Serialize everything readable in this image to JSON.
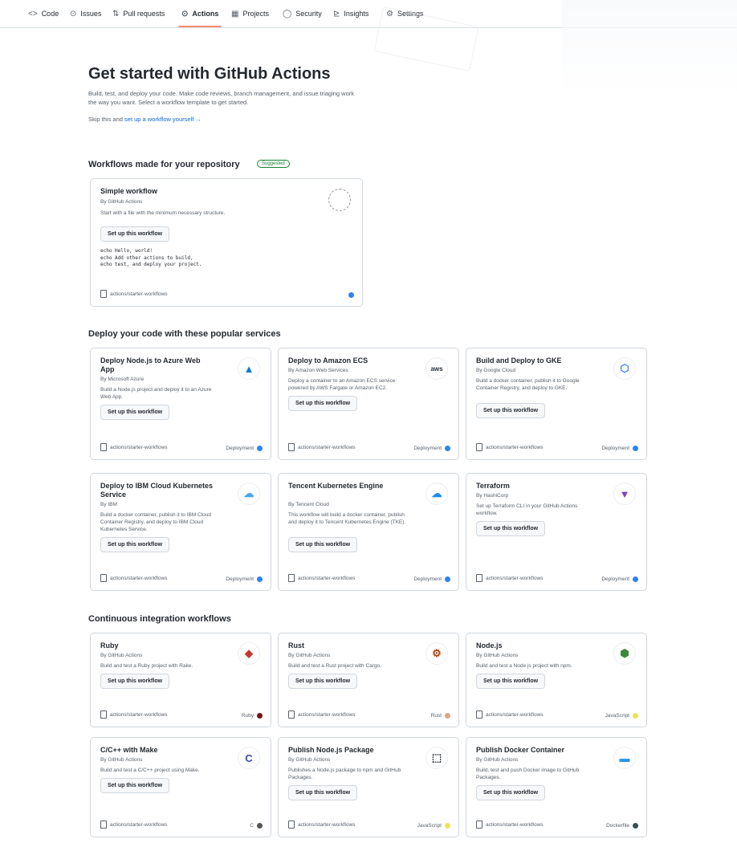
{
  "nav": {
    "tabs": [
      {
        "label": "Code",
        "icon": "code-icon"
      },
      {
        "label": "Issues",
        "icon": "issue-icon"
      },
      {
        "label": "Pull requests",
        "icon": "pull-request-icon"
      },
      {
        "label": "Actions",
        "icon": "play-icon",
        "active": true
      },
      {
        "label": "Projects",
        "icon": "project-icon"
      },
      {
        "label": "Security",
        "icon": "shield-icon"
      },
      {
        "label": "Insights",
        "icon": "graph-icon"
      },
      {
        "label": "Settings",
        "icon": "gear-icon"
      }
    ]
  },
  "header": {
    "title": "Get started with GitHub Actions",
    "intro": "Build, test, and deploy your code. Make code reviews, branch management, and issue triaging work the way you want. Select a workflow template to get started.",
    "skip_prefix": "Skip this and ",
    "skip_link": "set up a workflow yourself",
    "skip_arrow": "→"
  },
  "sections": {
    "suggested": {
      "title": "Workflows made for your repository",
      "badge": "Suggested"
    },
    "deploy": {
      "title": "Deploy your code with these popular services"
    },
    "ci": {
      "title": "Continuous integration workflows"
    }
  },
  "button_label": "Set up this workflow",
  "repo_label": "actions/starter-workflows",
  "simple": {
    "title": "Simple workflow",
    "by": "By GitHub Actions",
    "desc": "Start with a file with the minimum necessary structure.",
    "code": "echo Hello, world!\necho Add other actions to build,\necho test, and deploy your project."
  },
  "deploy_cards": [
    {
      "title": "Deploy Node.js to Azure Web App",
      "by": "By Microsoft Azure",
      "desc": "Build a Node.js project and deploy it to an Azure Web App.",
      "category": "Deployment",
      "dot_color": "#2f81f7",
      "logo": "azure-logo-icon",
      "glyph": "▲",
      "glyph_color": "#0078d4"
    },
    {
      "title": "Deploy to Amazon ECS",
      "by": "By Amazon Web Services",
      "desc": "Deploy a container to an Amazon ECS service powered by AWS Fargate or Amazon EC2.",
      "category": "Deployment",
      "dot_color": "#2f81f7",
      "logo": "aws-logo-icon",
      "glyph": "aws",
      "glyph_color": "#232f3e"
    },
    {
      "title": "Build and Deploy to GKE",
      "by": "By Google Cloud",
      "desc": "Build a docker container, publish it to Google Container Registry, and deploy to GKE.",
      "category": "Deployment",
      "dot_color": "#2f81f7",
      "logo": "gke-logo-icon",
      "glyph": "⬡",
      "glyph_color": "#4285f4"
    },
    {
      "title": "Deploy to IBM Cloud Kubernetes Service",
      "by": "By IBM",
      "desc": "Build a docker container, publish it to IBM Cloud Container Registry, and deploy to IBM Cloud Kubernetes Service.",
      "category": "Deployment",
      "dot_color": "#2f81f7",
      "logo": "ibm-cloud-logo-icon",
      "glyph": "☁",
      "glyph_color": "#4aa5f0"
    },
    {
      "title": "Tencent Kubernetes Engine",
      "by": "By Tencent Cloud",
      "desc": "This workflow will build a docker container, publish and deploy it to Tencent Kubernetes Engine (TKE).",
      "category": "Deployment",
      "dot_color": "#2f81f7",
      "logo": "tencent-logo-icon",
      "glyph": "☁",
      "glyph_color": "#1f8ceb"
    },
    {
      "title": "Terraform",
      "by": "By HashiCorp",
      "desc": "Set up Terraform CLI in your GitHub Actions workflow.",
      "category": "Deployment",
      "dot_color": "#2f81f7",
      "logo": "terraform-logo-icon",
      "glyph": "▼",
      "glyph_color": "#7b42bc"
    }
  ],
  "ci_cards": [
    {
      "title": "Ruby",
      "by": "By GitHub Actions",
      "desc": "Build and test a Ruby project with Rake.",
      "category": "Ruby",
      "dot_color": "#701516",
      "logo": "ruby-logo-icon",
      "glyph": "◆",
      "glyph_color": "#cc342d"
    },
    {
      "title": "Rust",
      "by": "By GitHub Actions",
      "desc": "Build and test a Rust project with Cargo.",
      "category": "Rust",
      "dot_color": "#dea584",
      "logo": "rust-logo-icon",
      "glyph": "⚙",
      "glyph_color": "#b7410e"
    },
    {
      "title": "Node.js",
      "by": "By GitHub Actions",
      "desc": "Build and test a Node.js project with npm.",
      "category": "JavaScript",
      "dot_color": "#f1e05a",
      "logo": "nodejs-logo-icon",
      "glyph": "⬢",
      "glyph_color": "#3c873a"
    },
    {
      "title": "C/C++ with Make",
      "by": "By GitHub Actions",
      "desc": "Build and test a C/C++ project using Make.",
      "category": "C",
      "dot_color": "#555555",
      "logo": "c-logo-icon",
      "glyph": "C",
      "glyph_color": "#3949ab"
    },
    {
      "title": "Publish Node.js Package",
      "by": "By GitHub Actions",
      "desc": "Publishes a Node.js package to npm and GitHub Packages.",
      "category": "JavaScript",
      "dot_color": "#f1e05a",
      "logo": "package-logo-icon",
      "glyph": "⬚",
      "glyph_color": "#24292f"
    },
    {
      "title": "Publish Docker Container",
      "by": "By GitHub Actions",
      "desc": "Build, test and push Docker image to GitHub Packages.",
      "category": "Dockerfile",
      "dot_color": "#384d54",
      "logo": "docker-logo-icon",
      "glyph": "▬",
      "glyph_color": "#2496ed"
    }
  ]
}
